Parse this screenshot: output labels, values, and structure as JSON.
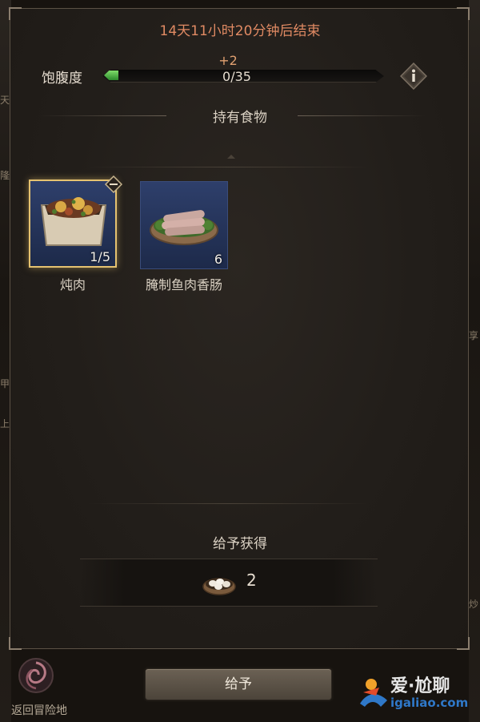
{
  "header": {
    "timer_text": "14天11小时20分钟后结束"
  },
  "satiety": {
    "label": "饱腹度",
    "gain_text": "+2",
    "current": 0,
    "max": 35,
    "count_text": "0/35",
    "fill_fraction": 0.0
  },
  "section": {
    "title": "持有食物"
  },
  "items": [
    {
      "name": "炖肉",
      "qty": "1/5",
      "selected": true
    },
    {
      "name": "腌制鱼肉香肠",
      "qty": "6",
      "selected": false
    }
  ],
  "reward": {
    "title": "给予获得",
    "count": "2",
    "icon": "egg-bowl-icon"
  },
  "footer": {
    "give_label": "给予",
    "return_label": "返回冒险地"
  },
  "watermark": {
    "text": "爱·尬聊",
    "sub": "igaliao.com"
  },
  "side_marks": [
    "天",
    "隆",
    "甲",
    "上",
    "享",
    "炒"
  ],
  "colors": {
    "timer": "#e08a63",
    "bar_fill": "#3a9a3a",
    "selected_border": "#e5c270",
    "item_bg": "#2e3f6b"
  }
}
